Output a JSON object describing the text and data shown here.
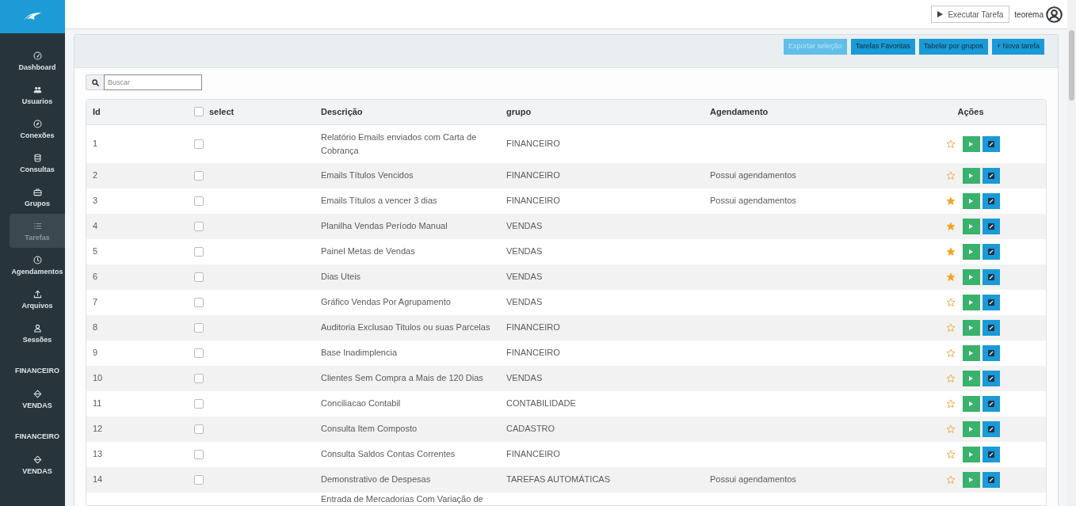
{
  "sidebar": {
    "items": [
      {
        "kind": "link",
        "label": "Dashboard",
        "selected": false
      },
      {
        "kind": "link",
        "label": "Usuarios",
        "selected": false
      },
      {
        "kind": "link",
        "label": "Conexões",
        "selected": false
      },
      {
        "kind": "link",
        "label": "Consultas",
        "selected": false
      },
      {
        "kind": "link",
        "label": "Grupos",
        "selected": false
      },
      {
        "kind": "link",
        "label": "Tarefas",
        "selected": true
      },
      {
        "kind": "link",
        "label": "Agendamentos",
        "selected": false
      },
      {
        "kind": "link",
        "label": "Arquivos",
        "selected": false
      },
      {
        "kind": "link",
        "label": "Sessões",
        "selected": false
      },
      {
        "kind": "heading",
        "label": "FINANCEIRO",
        "selected": false
      },
      {
        "kind": "link",
        "label": "VENDAS",
        "selected": false
      },
      {
        "kind": "heading",
        "label": "FINANCEIRO",
        "selected": false
      },
      {
        "kind": "link",
        "label": "VENDAS",
        "selected": false
      }
    ]
  },
  "header": {
    "run_button": {
      "label": "Executar Tarefa"
    },
    "user": {
      "name": "teorema"
    }
  },
  "toolbar": {
    "buttons": [
      {
        "label": "Exportar seleção",
        "disabled": true
      },
      {
        "label": "Tarefas Favoritas",
        "disabled": false
      },
      {
        "label": "Tabelar por grupos",
        "disabled": false
      },
      {
        "label": "+ Nova tarefa",
        "disabled": false
      }
    ]
  },
  "search": {
    "placeholder": "Buscar"
  },
  "table": {
    "columns": [
      "Id",
      "select",
      "Descrição",
      "grupo",
      "Agendamento",
      "Ações"
    ],
    "select_all": {
      "checked": false
    },
    "rows": [
      {
        "id": "1",
        "selected": false,
        "description": "Relatório Emails enviados com Carta de Cobrança",
        "group": "FINANCEIRO",
        "favorite": false
      },
      {
        "id": "2",
        "selected": false,
        "description": "Emails Títulos Vencidos",
        "group": "FINANCEIRO",
        "schedule": "Possui agendamentos",
        "favorite": false
      },
      {
        "id": "3",
        "selected": false,
        "description": "Emails Títulos a vencer 3 dias",
        "group": "FINANCEIRO",
        "schedule": "Possui agendamentos",
        "favorite": true
      },
      {
        "id": "4",
        "selected": false,
        "description": "Planilha Vendas Período Manual",
        "group": "VENDAS",
        "favorite": true
      },
      {
        "id": "5",
        "selected": false,
        "description": "Painel Metas de Vendas",
        "group": "VENDAS",
        "favorite": true
      },
      {
        "id": "6",
        "selected": false,
        "description": "Dias Uteis",
        "group": "VENDAS",
        "favorite": true
      },
      {
        "id": "7",
        "selected": false,
        "description": "Gráfico Vendas Por Agrupamento",
        "group": "VENDAS",
        "favorite": false
      },
      {
        "id": "8",
        "selected": false,
        "description": "Auditoria Exclusao Titulos ou suas Parcelas",
        "group": "FINANCEIRO",
        "favorite": false
      },
      {
        "id": "9",
        "selected": false,
        "description": "Base Inadimplencia",
        "group": "FINANCEIRO",
        "favorite": false
      },
      {
        "id": "10",
        "selected": false,
        "description": "Clientes Sem Compra a Mais de 120 Dias",
        "group": "VENDAS",
        "favorite": false
      },
      {
        "id": "11",
        "selected": false,
        "description": "Conciliacao Contabil",
        "group": "CONTABILIDADE",
        "favorite": false
      },
      {
        "id": "12",
        "selected": false,
        "description": "Consulta Item Composto",
        "group": "CADASTRO",
        "favorite": false
      },
      {
        "id": "13",
        "selected": false,
        "description": "Consulta Saldos Contas Correntes",
        "group": "FINANCEIRO",
        "favorite": false
      },
      {
        "id": "14",
        "selected": false,
        "description": "Demonstrativo de Despesas",
        "group": "TAREFAS AUTOMÁTICAS",
        "schedule": "Possui agendamentos",
        "favorite": false
      },
      {
        "description": "Entrada de Mercadorias Com Variação de"
      }
    ]
  }
}
